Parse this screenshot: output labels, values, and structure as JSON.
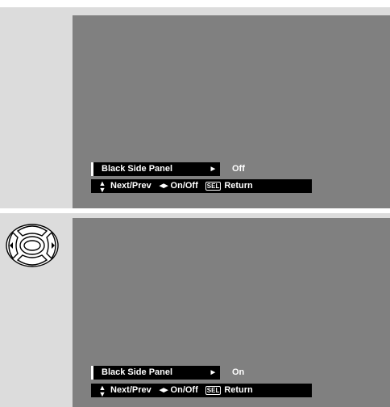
{
  "screens": [
    {
      "menu_label": "Black Side Panel",
      "menu_value": "Off",
      "help": {
        "updown_icon": "updown-arrow-icon",
        "next_prev": "Next/Prev",
        "lr_icon": "left-right-arrow-icon",
        "on_off": "On/Off",
        "sel_key": "SEL",
        "return": "Return"
      }
    },
    {
      "menu_label": "Black Side Panel",
      "menu_value": "On",
      "help": {
        "updown_icon": "updown-arrow-icon",
        "next_prev": "Next/Prev",
        "lr_icon": "left-right-arrow-icon",
        "on_off": "On/Off",
        "sel_key": "SEL",
        "return": "Return"
      }
    }
  ],
  "icons": {
    "remote": "remote-control-dpad-icon"
  },
  "colors": {
    "panel": "#dcdcdc",
    "screen": "#808080",
    "menu_bg": "#000000",
    "text": "#ffffff"
  }
}
